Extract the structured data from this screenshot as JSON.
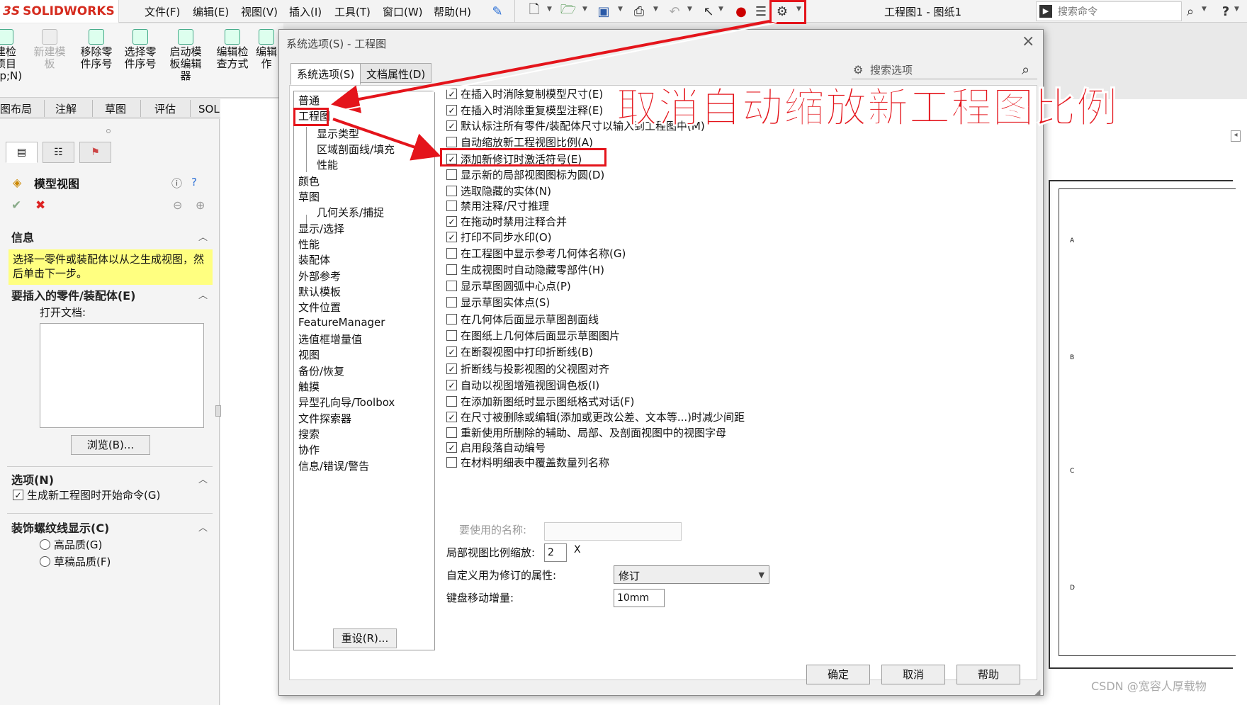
{
  "app": {
    "logo_prefix": "3S",
    "logo_name": "SOLIDWORKS",
    "menu": [
      "文件(F)",
      "编辑(E)",
      "视图(V)",
      "插入(I)",
      "工具(T)",
      "窗口(W)",
      "帮助(H)"
    ],
    "doc_title": "工程图1 - 图纸1",
    "search_placeholder": "搜索命令",
    "help_label": "?"
  },
  "ribbon": {
    "buttons": [
      "建检\n项目\nmp;N)",
      "新建模\n板",
      "移除零\n件序号",
      "选择零\n件序号",
      "启动模\n板编辑\n器",
      "编辑检\n查方式",
      "编辑\n作"
    ],
    "tabs": [
      "图布局",
      "注解",
      "草图",
      "评估",
      "SOLIDWORKS 插件"
    ]
  },
  "property_manager": {
    "title": "模型视图",
    "info_header": "信息",
    "info_text": "选择一零件或装配体以从之生成视图，然后单击下一步。",
    "insert_header": "要插入的零件/装配体(E)",
    "open_docs_label": "打开文档:",
    "browse_label": "浏览(B)...",
    "options_header": "选项(N)",
    "options_check": "生成新工程图时开始命令(G)",
    "thread_header": "装饰螺纹线显示(C)",
    "quality_high": "高品质(G)",
    "quality_draft": "草稿品质(F)"
  },
  "dialog": {
    "title": "系统选项(S) - 工程图",
    "tabs": [
      "系统选项(S)",
      "文档属性(D)"
    ],
    "search_placeholder": "搜索选项",
    "tree": [
      {
        "label": "普通",
        "child": false
      },
      {
        "label": "工程图",
        "child": false,
        "selected": true
      },
      {
        "label": "显示类型",
        "child": true
      },
      {
        "label": "区域剖面线/填充",
        "child": true
      },
      {
        "label": "性能",
        "child": true
      },
      {
        "label": "颜色",
        "child": false
      },
      {
        "label": "草图",
        "child": false
      },
      {
        "label": "几何关系/捕捉",
        "child": true
      },
      {
        "label": "显示/选择",
        "child": false
      },
      {
        "label": "性能",
        "child": false
      },
      {
        "label": "装配体",
        "child": false
      },
      {
        "label": "外部参考",
        "child": false
      },
      {
        "label": "默认模板",
        "child": false
      },
      {
        "label": "文件位置",
        "child": false
      },
      {
        "label": "FeatureManager",
        "child": false
      },
      {
        "label": "选值框增量值",
        "child": false
      },
      {
        "label": "视图",
        "child": false
      },
      {
        "label": "备份/恢复",
        "child": false
      },
      {
        "label": "触摸",
        "child": false
      },
      {
        "label": "异型孔向导/Toolbox",
        "child": false
      },
      {
        "label": "文件探索器",
        "child": false
      },
      {
        "label": "搜索",
        "child": false
      },
      {
        "label": "协作",
        "child": false
      },
      {
        "label": "信息/错误/警告",
        "child": false
      }
    ],
    "options": [
      {
        "label": "在插入时消除复制模型尺寸(E)",
        "checked": true
      },
      {
        "label": "在插入时消除重复模型注释(E)",
        "checked": true
      },
      {
        "label": "默认标注所有零件/装配体尺寸以输入到工程图中(M)",
        "checked": true
      },
      {
        "label": "自动缩放新工程视图比例(A)",
        "checked": false,
        "highlight": true
      },
      {
        "label": "添加新修订时激活符号(E)",
        "checked": true
      },
      {
        "label": "显示新的局部视图图标为圆(D)",
        "checked": false
      },
      {
        "label": "选取隐藏的实体(N)",
        "checked": false
      },
      {
        "label": "禁用注释/尺寸推理",
        "checked": false
      },
      {
        "label": "在拖动时禁用注释合并",
        "checked": true
      },
      {
        "label": "打印不同步水印(O)",
        "checked": true
      },
      {
        "label": "在工程图中显示参考几何体名称(G)",
        "checked": false
      },
      {
        "label": "生成视图时自动隐藏零部件(H)",
        "checked": false
      },
      {
        "label": "显示草图圆弧中心点(P)",
        "checked": false
      },
      {
        "label": "显示草图实体点(S)",
        "checked": false
      },
      {
        "label": "在几何体后面显示草图剖面线",
        "checked": false
      },
      {
        "label": "在图纸上几何体后面显示草图图片",
        "checked": false
      },
      {
        "label": "在断裂视图中打印折断线(B)",
        "checked": true
      },
      {
        "label": "折断线与投影视图的父视图对齐",
        "checked": true
      },
      {
        "label": "自动以视图增殖视图调色板(I)",
        "checked": true
      },
      {
        "label": "在添加新图纸时显示图纸格式对话(F)",
        "checked": false
      },
      {
        "label": "在尺寸被删除或编辑(添加或更改公差、文本等...)时减少间距",
        "checked": true
      },
      {
        "label": "重新使用所删除的辅助、局部、及剖面视图中的视图字母",
        "checked": false
      },
      {
        "label": "启用段落自动编号",
        "checked": true
      },
      {
        "label": "在材料明细表中覆盖数量列名称",
        "checked": false
      }
    ],
    "name_to_use_label": "要使用的名称:",
    "detail_scale_label": "局部视图比例缩放:",
    "detail_scale_value": "2",
    "detail_scale_unit": "X",
    "revision_label": "自定义用为修订的属性:",
    "revision_value": "修订",
    "keyboard_label": "键盘移动增量:",
    "keyboard_value": "10mm",
    "reset_label": "重设(R)...",
    "ok_label": "确定",
    "cancel_label": "取消",
    "help_label": "帮助"
  },
  "annotation": {
    "title": "取消自动缩放新工程图比例",
    "color": "#e4141b"
  },
  "watermark": "CSDN @宽容人厚载物",
  "sheet_zone_letters": [
    "A",
    "B",
    "C",
    "D"
  ]
}
